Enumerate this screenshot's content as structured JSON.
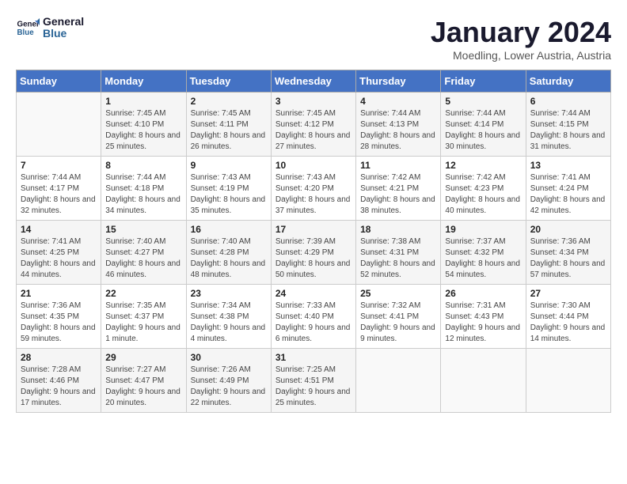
{
  "header": {
    "logo_line1": "General",
    "logo_line2": "Blue",
    "title": "January 2024",
    "subtitle": "Moedling, Lower Austria, Austria"
  },
  "weekdays": [
    "Sunday",
    "Monday",
    "Tuesday",
    "Wednesday",
    "Thursday",
    "Friday",
    "Saturday"
  ],
  "weeks": [
    [
      {
        "day": "",
        "sunrise": "",
        "sunset": "",
        "daylight": ""
      },
      {
        "day": "1",
        "sunrise": "7:45 AM",
        "sunset": "4:10 PM",
        "daylight": "8 hours and 25 minutes."
      },
      {
        "day": "2",
        "sunrise": "7:45 AM",
        "sunset": "4:11 PM",
        "daylight": "8 hours and 26 minutes."
      },
      {
        "day": "3",
        "sunrise": "7:45 AM",
        "sunset": "4:12 PM",
        "daylight": "8 hours and 27 minutes."
      },
      {
        "day": "4",
        "sunrise": "7:44 AM",
        "sunset": "4:13 PM",
        "daylight": "8 hours and 28 minutes."
      },
      {
        "day": "5",
        "sunrise": "7:44 AM",
        "sunset": "4:14 PM",
        "daylight": "8 hours and 30 minutes."
      },
      {
        "day": "6",
        "sunrise": "7:44 AM",
        "sunset": "4:15 PM",
        "daylight": "8 hours and 31 minutes."
      }
    ],
    [
      {
        "day": "7",
        "sunrise": "7:44 AM",
        "sunset": "4:17 PM",
        "daylight": "8 hours and 32 minutes."
      },
      {
        "day": "8",
        "sunrise": "7:44 AM",
        "sunset": "4:18 PM",
        "daylight": "8 hours and 34 minutes."
      },
      {
        "day": "9",
        "sunrise": "7:43 AM",
        "sunset": "4:19 PM",
        "daylight": "8 hours and 35 minutes."
      },
      {
        "day": "10",
        "sunrise": "7:43 AM",
        "sunset": "4:20 PM",
        "daylight": "8 hours and 37 minutes."
      },
      {
        "day": "11",
        "sunrise": "7:42 AM",
        "sunset": "4:21 PM",
        "daylight": "8 hours and 38 minutes."
      },
      {
        "day": "12",
        "sunrise": "7:42 AM",
        "sunset": "4:23 PM",
        "daylight": "8 hours and 40 minutes."
      },
      {
        "day": "13",
        "sunrise": "7:41 AM",
        "sunset": "4:24 PM",
        "daylight": "8 hours and 42 minutes."
      }
    ],
    [
      {
        "day": "14",
        "sunrise": "7:41 AM",
        "sunset": "4:25 PM",
        "daylight": "8 hours and 44 minutes."
      },
      {
        "day": "15",
        "sunrise": "7:40 AM",
        "sunset": "4:27 PM",
        "daylight": "8 hours and 46 minutes."
      },
      {
        "day": "16",
        "sunrise": "7:40 AM",
        "sunset": "4:28 PM",
        "daylight": "8 hours and 48 minutes."
      },
      {
        "day": "17",
        "sunrise": "7:39 AM",
        "sunset": "4:29 PM",
        "daylight": "8 hours and 50 minutes."
      },
      {
        "day": "18",
        "sunrise": "7:38 AM",
        "sunset": "4:31 PM",
        "daylight": "8 hours and 52 minutes."
      },
      {
        "day": "19",
        "sunrise": "7:37 AM",
        "sunset": "4:32 PM",
        "daylight": "8 hours and 54 minutes."
      },
      {
        "day": "20",
        "sunrise": "7:36 AM",
        "sunset": "4:34 PM",
        "daylight": "8 hours and 57 minutes."
      }
    ],
    [
      {
        "day": "21",
        "sunrise": "7:36 AM",
        "sunset": "4:35 PM",
        "daylight": "8 hours and 59 minutes."
      },
      {
        "day": "22",
        "sunrise": "7:35 AM",
        "sunset": "4:37 PM",
        "daylight": "9 hours and 1 minute."
      },
      {
        "day": "23",
        "sunrise": "7:34 AM",
        "sunset": "4:38 PM",
        "daylight": "9 hours and 4 minutes."
      },
      {
        "day": "24",
        "sunrise": "7:33 AM",
        "sunset": "4:40 PM",
        "daylight": "9 hours and 6 minutes."
      },
      {
        "day": "25",
        "sunrise": "7:32 AM",
        "sunset": "4:41 PM",
        "daylight": "9 hours and 9 minutes."
      },
      {
        "day": "26",
        "sunrise": "7:31 AM",
        "sunset": "4:43 PM",
        "daylight": "9 hours and 12 minutes."
      },
      {
        "day": "27",
        "sunrise": "7:30 AM",
        "sunset": "4:44 PM",
        "daylight": "9 hours and 14 minutes."
      }
    ],
    [
      {
        "day": "28",
        "sunrise": "7:28 AM",
        "sunset": "4:46 PM",
        "daylight": "9 hours and 17 minutes."
      },
      {
        "day": "29",
        "sunrise": "7:27 AM",
        "sunset": "4:47 PM",
        "daylight": "9 hours and 20 minutes."
      },
      {
        "day": "30",
        "sunrise": "7:26 AM",
        "sunset": "4:49 PM",
        "daylight": "9 hours and 22 minutes."
      },
      {
        "day": "31",
        "sunrise": "7:25 AM",
        "sunset": "4:51 PM",
        "daylight": "9 hours and 25 minutes."
      },
      {
        "day": "",
        "sunrise": "",
        "sunset": "",
        "daylight": ""
      },
      {
        "day": "",
        "sunrise": "",
        "sunset": "",
        "daylight": ""
      },
      {
        "day": "",
        "sunrise": "",
        "sunset": "",
        "daylight": ""
      }
    ]
  ]
}
